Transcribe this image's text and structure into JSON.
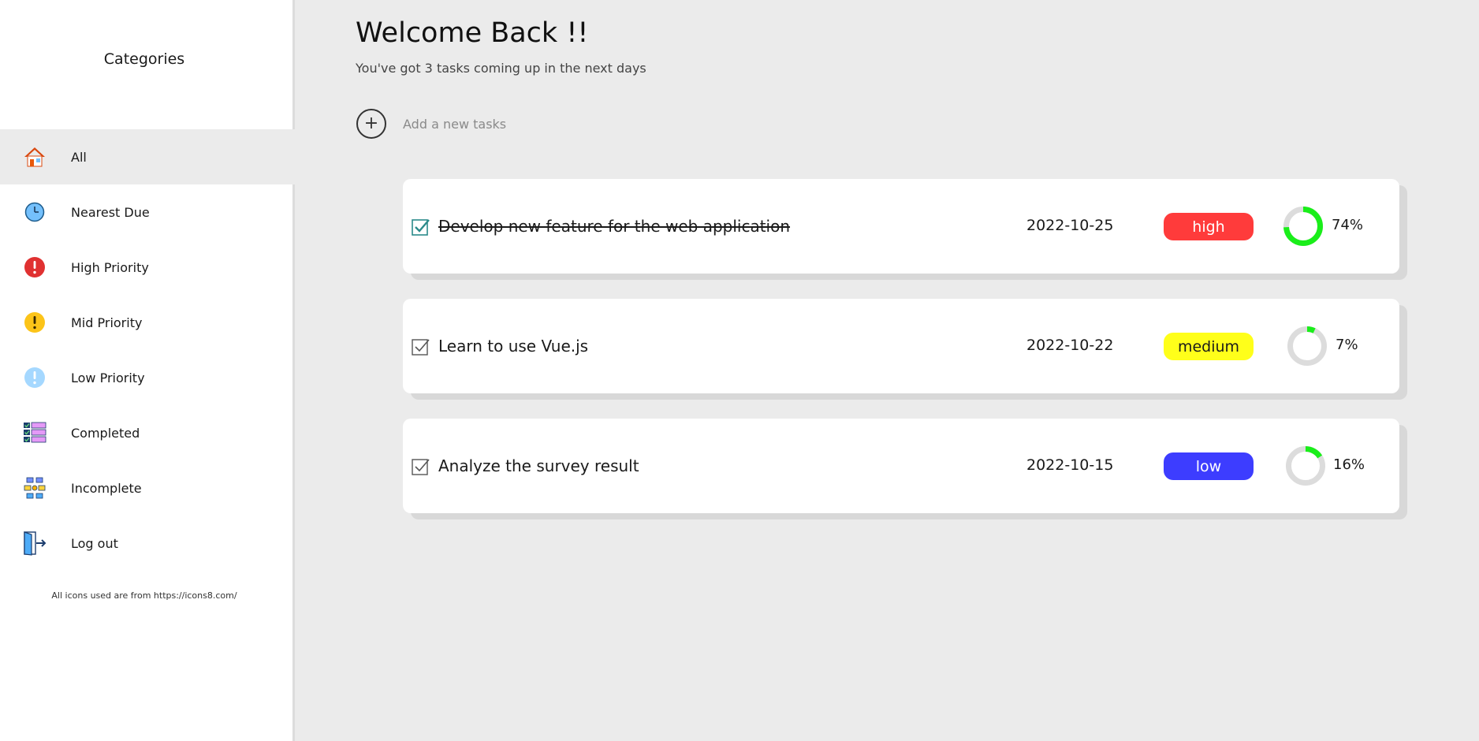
{
  "sidebar": {
    "title": "Categories",
    "items": [
      {
        "label": "All",
        "icon": "home-icon",
        "active": true
      },
      {
        "label": "Nearest Due",
        "icon": "clock-icon",
        "active": false
      },
      {
        "label": "High Priority",
        "icon": "high-priority-icon",
        "active": false
      },
      {
        "label": "Mid Priority",
        "icon": "mid-priority-icon",
        "active": false
      },
      {
        "label": "Low Priority",
        "icon": "low-priority-icon",
        "active": false
      },
      {
        "label": "Completed",
        "icon": "completed-list-icon",
        "active": false
      },
      {
        "label": "Incomplete",
        "icon": "incomplete-icon",
        "active": false
      },
      {
        "label": "Log out",
        "icon": "logout-door-icon",
        "active": false
      }
    ],
    "credit": "All icons used are from https://icons8.com/"
  },
  "header": {
    "title": "Welcome Back !!",
    "subtitle": "You've got 3 tasks coming up in the next days"
  },
  "add_task": {
    "icon": "plus-icon",
    "label": "Add a new tasks"
  },
  "tasks": [
    {
      "name": "Develop new feature for the web application",
      "done": true,
      "date": "2022-10-25",
      "priority": "high",
      "priority_color": "#ff3b3b",
      "priority_text_color": "#ffffff",
      "progress": 74,
      "progress_label": "74%"
    },
    {
      "name": "Learn to use Vue.js",
      "done": false,
      "date": "2022-10-22",
      "priority": "medium",
      "priority_color": "#ffff1a",
      "priority_text_color": "#1a1a1a",
      "progress": 7,
      "progress_label": "7%"
    },
    {
      "name": "Analyze the survey result",
      "done": false,
      "date": "2022-10-15",
      "priority": "low",
      "priority_color": "#3d3dff",
      "priority_text_color": "#ffffff",
      "progress": 16,
      "progress_label": "16%"
    }
  ],
  "colors": {
    "progress": "#1aee1a",
    "progress_track": "#dcdcdc",
    "background": "#ebebeb"
  }
}
